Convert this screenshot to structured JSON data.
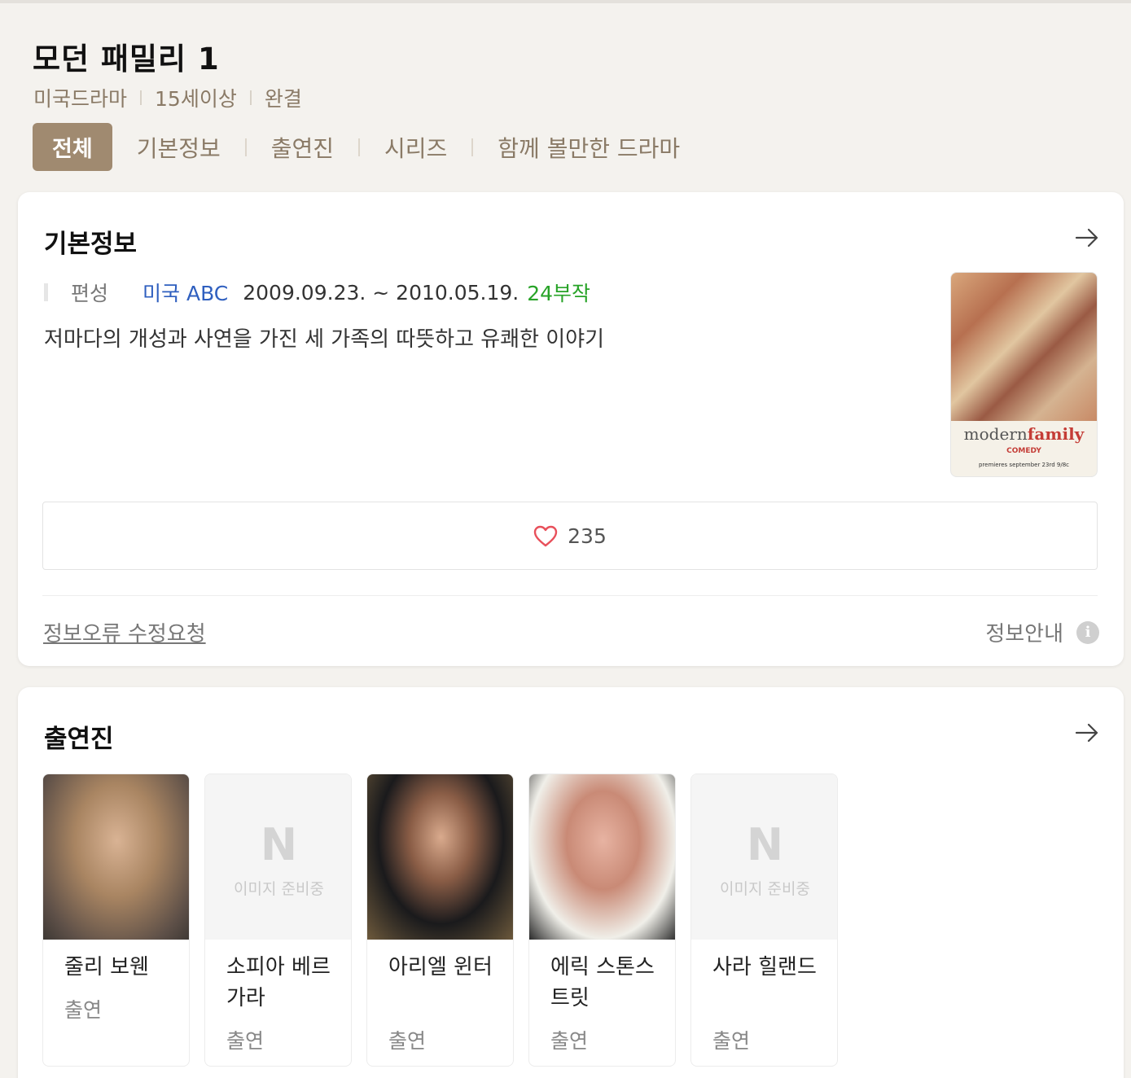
{
  "header": {
    "title": "모던 패밀리 1",
    "meta": [
      "미국드라마",
      "15세이상",
      "완결"
    ],
    "tabs": [
      "전체",
      "기본정보",
      "출연진",
      "시리즈",
      "함께 볼만한 드라마"
    ]
  },
  "basic": {
    "title": "기본정보",
    "label": "편성",
    "network": "미국 ABC",
    "dates": "2009.09.23. ~ 2010.05.19.",
    "episodes": "24부작",
    "description": "저마다의 개성과 사연을 가진 세 가족의 따뜻하고 유쾌한 이야기",
    "poster": {
      "logo_modern": "modern",
      "logo_family": "family",
      "sub": "COMEDY",
      "sub2": "premieres september 23rd 9/8c"
    },
    "likes": "235",
    "report_link": "정보오류 수정요청",
    "guide": "정보안내",
    "guide_icon": "i"
  },
  "cast": {
    "title": "출연진",
    "placeholder_logo": "N",
    "placeholder_text": "이미지 준비중",
    "people": [
      {
        "name": "줄리 보웬",
        "role": "출연"
      },
      {
        "name": "소피아 베르가라",
        "role": "출연"
      },
      {
        "name": "아리엘 윈터",
        "role": "출연"
      },
      {
        "name": "에릭 스톤스트릿",
        "role": "출연"
      },
      {
        "name": "사라 힐랜드",
        "role": "출연"
      }
    ]
  },
  "colors": {
    "accent": "#a08a70",
    "network": "#2f5fbf",
    "episodes": "#27a327",
    "heart": "#e8505b"
  }
}
